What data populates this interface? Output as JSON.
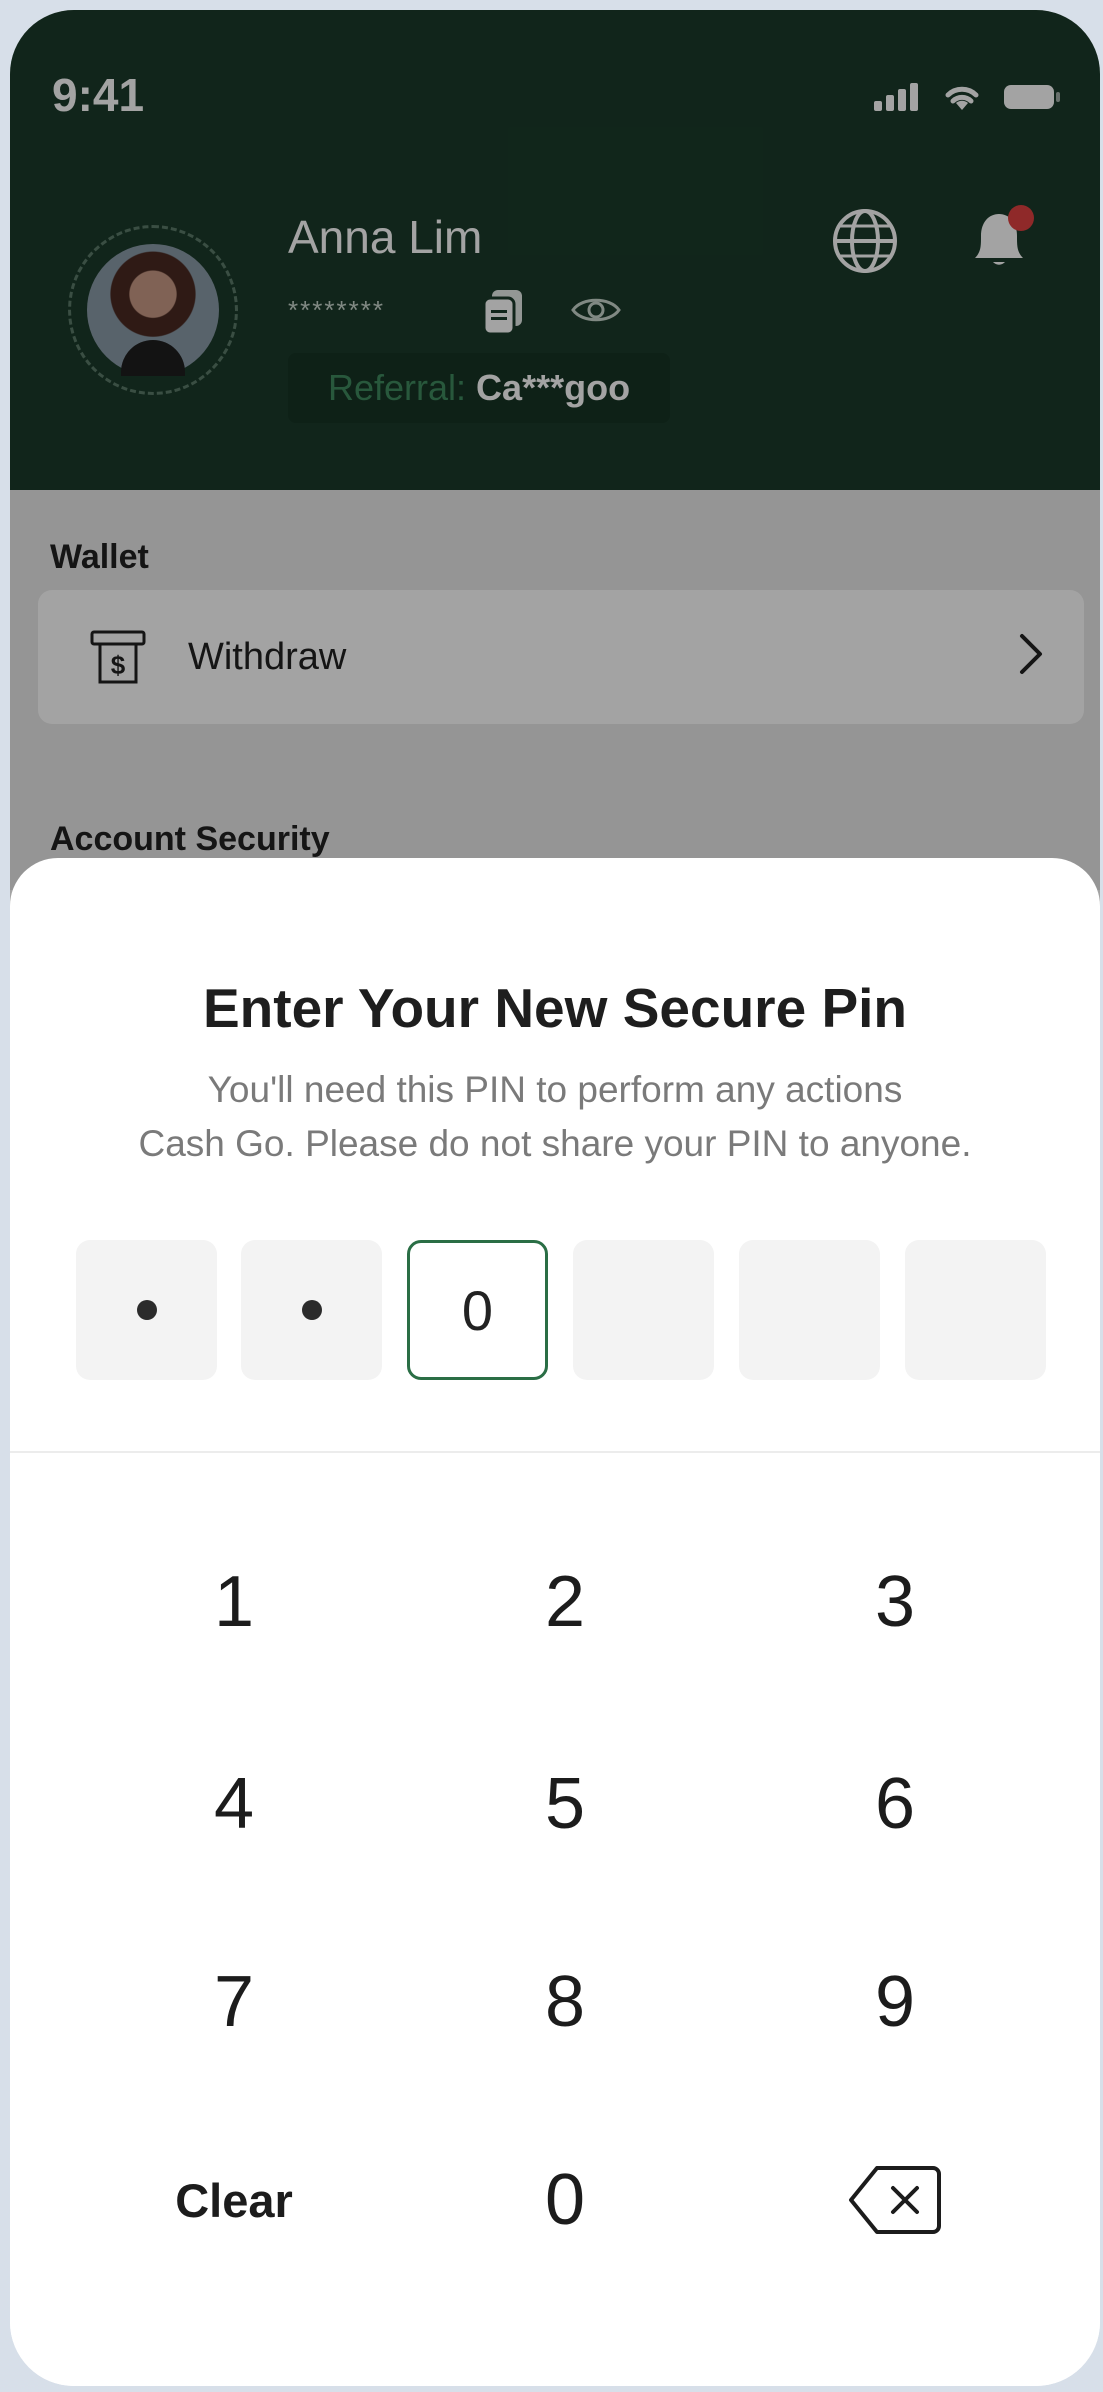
{
  "status_bar": {
    "time": "9:41",
    "icons": [
      "signal-icon",
      "wifi-icon",
      "battery-icon"
    ]
  },
  "profile": {
    "name": "Anna Lim",
    "masked_id": "********",
    "referral_label": "Referral:",
    "referral_code": "Ca***goo"
  },
  "header_icons": [
    "globe-icon",
    "bell-icon"
  ],
  "wallet": {
    "section_title": "Wallet",
    "withdraw_label": "Withdraw"
  },
  "security": {
    "section_title": "Account Security"
  },
  "pin_sheet": {
    "title": "Enter Your New Secure Pin",
    "description_line1": "You'll need this PIN to perform any actions",
    "description_line2": "Cash Go. Please do not share your PIN to anyone.",
    "pin_state": [
      "dot",
      "dot",
      "0",
      "",
      "",
      ""
    ],
    "active_index": 2
  },
  "keypad": {
    "keys": [
      "1",
      "2",
      "3",
      "4",
      "5",
      "6",
      "7",
      "8",
      "9"
    ],
    "clear_label": "Clear",
    "zero": "0"
  },
  "colors": {
    "header_bg": "#1b3b2b",
    "accent": "#2a6e45",
    "notification_dot": "#e04040"
  }
}
